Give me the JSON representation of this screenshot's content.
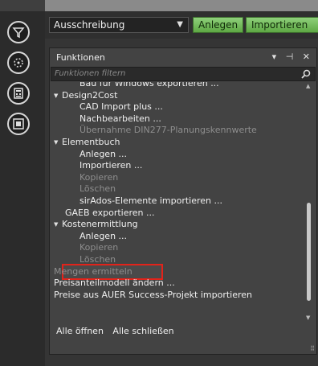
{
  "toolbar": {
    "dropdown_value": "Ausschreibung",
    "anlegen_label": "Anlegen",
    "importieren_label": "Importieren"
  },
  "rail": {
    "icons": [
      "workflow-icon",
      "settings-icon",
      "calculator-icon",
      "module-icon"
    ]
  },
  "panel": {
    "title": "Funktionen",
    "controls": "▾ ⊣ ✕",
    "filter_placeholder": "Funktionen filtern",
    "tree": [
      {
        "label": "Bau für Windows exportieren ...",
        "indent": 1,
        "state": "normal"
      },
      {
        "label": "Design2Cost",
        "indent": 0,
        "state": "group"
      },
      {
        "label": "CAD Import plus ...",
        "indent": 1,
        "state": "normal"
      },
      {
        "label": "Nachbearbeiten ...",
        "indent": 1,
        "state": "normal"
      },
      {
        "label": "Übernahme DIN277-Planungskennwerte",
        "indent": 1,
        "state": "disabled"
      },
      {
        "label": "Elementbuch",
        "indent": 0,
        "state": "group"
      },
      {
        "label": "Anlegen ...",
        "indent": 1,
        "state": "normal"
      },
      {
        "label": "Importieren ...",
        "indent": 1,
        "state": "normal"
      },
      {
        "label": "Kopieren",
        "indent": 1,
        "state": "disabled"
      },
      {
        "label": "Löschen",
        "indent": 1,
        "state": "disabled"
      },
      {
        "label": "sirAdos-Elemente importieren ...",
        "indent": 1,
        "state": "normal"
      },
      {
        "label": "GAEB exportieren ...",
        "indent": 0,
        "state": "highlight"
      },
      {
        "label": "Kostenermittlung",
        "indent": 0,
        "state": "group"
      },
      {
        "label": "Anlegen ...",
        "indent": 1,
        "state": "normal"
      },
      {
        "label": "Kopieren",
        "indent": 1,
        "state": "disabled"
      },
      {
        "label": "Löschen",
        "indent": 1,
        "state": "disabled"
      },
      {
        "label": "Mengen ermitteln",
        "indent": 0,
        "state": "disabled"
      },
      {
        "label": "Preisanteilmodell ändern ...",
        "indent": 0,
        "state": "normal"
      },
      {
        "label": "Preise aus AUER Success-Projekt importieren",
        "indent": 0,
        "state": "normal"
      }
    ],
    "footer": {
      "open_all": "Alle öffnen",
      "close_all": "Alle schließen"
    }
  }
}
